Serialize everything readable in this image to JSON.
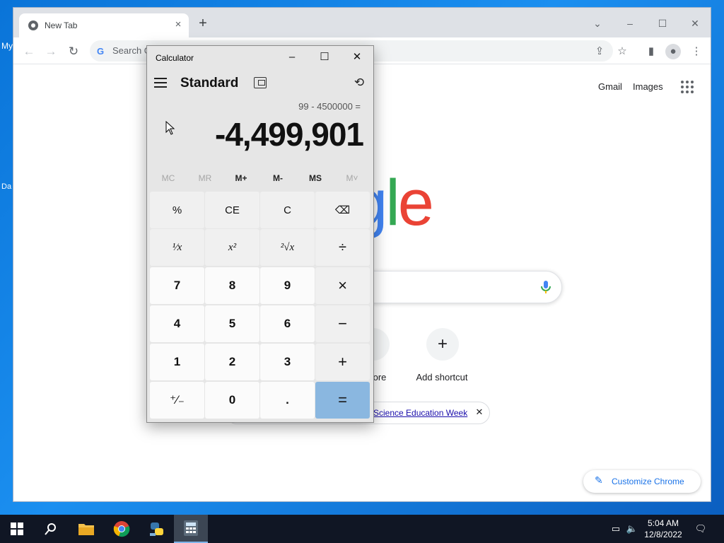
{
  "desktop": {
    "fragments": [
      "My",
      "Da"
    ]
  },
  "chrome": {
    "tab_title": "New Tab",
    "tab_close": "×",
    "new_tab": "+",
    "window_buttons": {
      "minimize": "–",
      "maximize": "☐",
      "close": "✕",
      "dropdown": "⌄"
    },
    "omnibox_placeholder": "Search G",
    "links": {
      "gmail": "Gmail",
      "images": "Images"
    },
    "logo_visible_text": "ogle",
    "shortcuts": [
      {
        "label": "ore",
        "icon": ""
      },
      {
        "label": "Add shortcut",
        "icon": "+"
      }
    ],
    "chip_link": "Science Education Week",
    "chip_close": "✕",
    "customize_label": "Customize Chrome"
  },
  "calculator": {
    "title": "Calculator",
    "mode": "Standard",
    "expression": "99 - 4500000 =",
    "display": "-4,499,901",
    "memory": [
      {
        "label": "MC",
        "enabled": false
      },
      {
        "label": "MR",
        "enabled": false
      },
      {
        "label": "M+",
        "enabled": true
      },
      {
        "label": "M-",
        "enabled": true
      },
      {
        "label": "MS",
        "enabled": true
      },
      {
        "label": "M˅",
        "enabled": false
      }
    ],
    "keys": {
      "percent": "%",
      "ce": "CE",
      "c": "C",
      "backspace": "⌫",
      "reciprocal": "¹⁄x",
      "square": "x²",
      "sqrt": "²√x",
      "divide": "÷",
      "seven": "7",
      "eight": "8",
      "nine": "9",
      "multiply": "×",
      "four": "4",
      "five": "5",
      "six": "6",
      "minus": "−",
      "one": "1",
      "two": "2",
      "three": "3",
      "plus": "+",
      "negate": "⁺⁄₋",
      "zero": "0",
      "decimal": ".",
      "equals": "="
    }
  },
  "taskbar": {
    "clock_time": "5:04 AM",
    "clock_date": "12/8/2022"
  }
}
